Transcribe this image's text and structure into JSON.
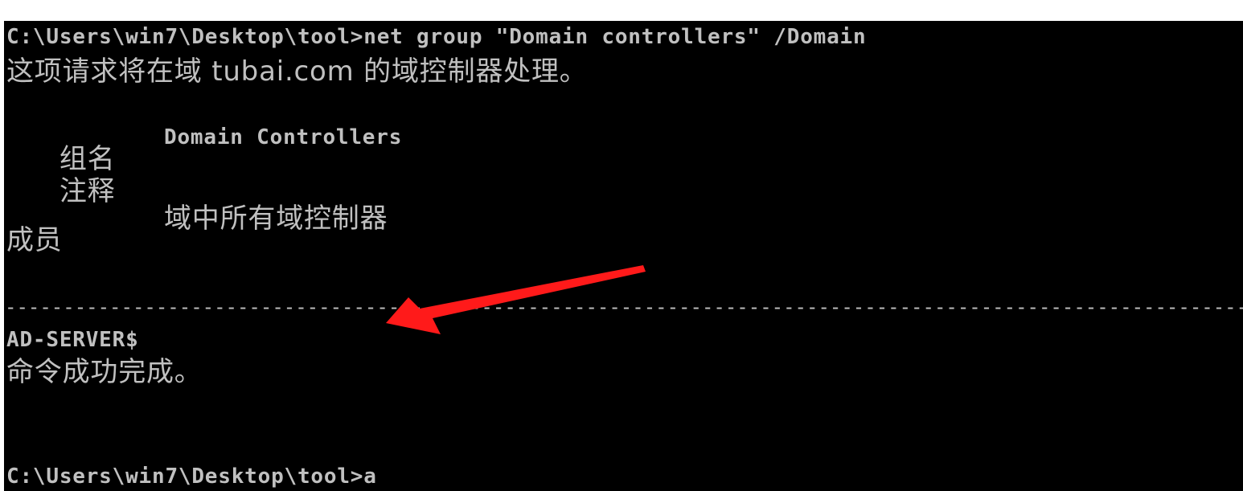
{
  "console": {
    "command_line": "C:\\Users\\win7\\Desktop\\tool>net group \"Domain controllers\" /Domain",
    "info_line": "这项请求将在域 tubai.com 的域控制器处理。",
    "group_label": "组名",
    "group_value": "Domain Controllers",
    "comment_label": "注释",
    "comment_value": "域中所有域控制器",
    "members_label": "成员",
    "separator": "-------------------------------------------------------------------------------------------------------------------------",
    "member": "AD-SERVER$",
    "result": "命令成功完成。",
    "prompt_line": "C:\\Users\\win7\\Desktop\\tool>a"
  },
  "colors": {
    "background": "#000000",
    "text": "#c0c0c0",
    "arrow": "#ff1a1a"
  },
  "icons": {
    "annotation": "arrow-icon"
  }
}
